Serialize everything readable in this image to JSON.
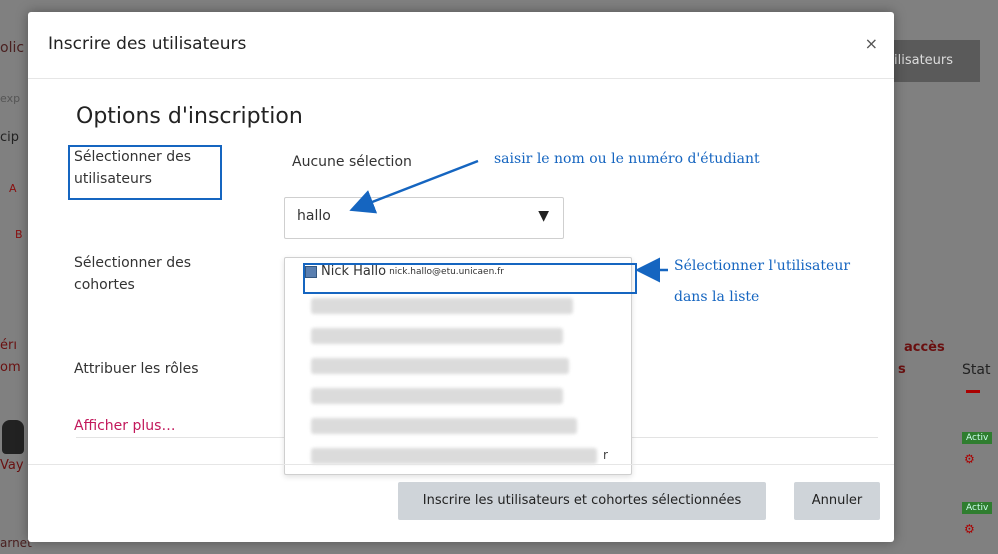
{
  "background": {
    "button_label": "ilisateurs",
    "header_first_access": "accès",
    "status_header": "Stat",
    "badge_active": "Activ",
    "left_fragments": [
      "olic",
      "exp",
      "cip",
      "A",
      "B",
      "érı",
      "om",
      "Vay",
      "arnet"
    ],
    "right_fragment_s": "s"
  },
  "modal": {
    "title": "Inscrire des utilisateurs",
    "close_icon": "×",
    "section_title": "Options d'inscription",
    "select_users_label": "Sélectionner des utilisateurs",
    "no_selection_text": "Aucune sélection",
    "search_value": "hallo",
    "caret_icon": "▼",
    "select_cohorts_label": "Sélectionner des cohortes",
    "assign_roles_label": "Attribuer les rôles",
    "show_more_link": "Afficher plus…",
    "suggestions": [
      {
        "name": "Nick Hallo",
        "email": "nick.hallo@etu.unicaen.fr",
        "highlighted": true
      },
      {
        "name": "",
        "email": "",
        "blurred": true
      },
      {
        "name": "",
        "email": "",
        "blurred": true
      },
      {
        "name": "",
        "email": "",
        "blurred": true
      },
      {
        "name": "",
        "email": "",
        "blurred": true
      },
      {
        "name": "",
        "email": "",
        "blurred": true
      },
      {
        "name": "",
        "email": "",
        "blurred": true
      }
    ],
    "last_suggestion_tail": "r",
    "submit_button": "Inscrire les utilisateurs et cohortes sélectionnées",
    "cancel_button": "Annuler"
  },
  "annotations": {
    "search_hint": "saisir le nom ou le numéro d'étudiant",
    "select_hint_line1": "Sélectionner l'utilisateur",
    "select_hint_line2": "dans la liste",
    "color": "#1565c0"
  }
}
